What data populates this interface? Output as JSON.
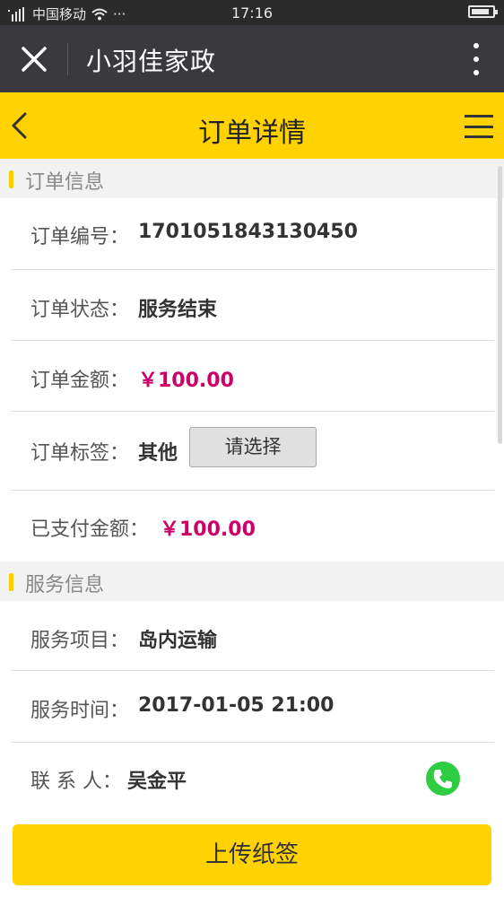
{
  "status_bar": {
    "carrier": "中国移动",
    "time": "17:16",
    "dots": "···"
  },
  "titlebar": {
    "title": "小羽佳家政"
  },
  "header": {
    "title": "订单详情"
  },
  "order_section": {
    "title": "订单信息",
    "order_no_label": "订单编号：",
    "order_no": "1701051843130450",
    "status_label": "订单状态：",
    "status": "服务结束",
    "amount_label": "订单金额：",
    "amount": "￥100.00",
    "tag_label": "订单标签：",
    "tag": "其他",
    "tag_select": "请选择",
    "paid_label": "已支付金额：",
    "paid": "￥100.00"
  },
  "service_section": {
    "title": "服务信息",
    "item_label": "服务项目：",
    "item": "岛内运输",
    "time_label": "服务时间：",
    "time": "2017-01-05 21:00",
    "contact_label": "联 系 人：",
    "contact": "吴金平"
  },
  "footer": {
    "upload_label": "上传纸签"
  },
  "colors": {
    "accent": "#ffd200",
    "money": "#cc0066",
    "phone": "#2ecc40"
  }
}
